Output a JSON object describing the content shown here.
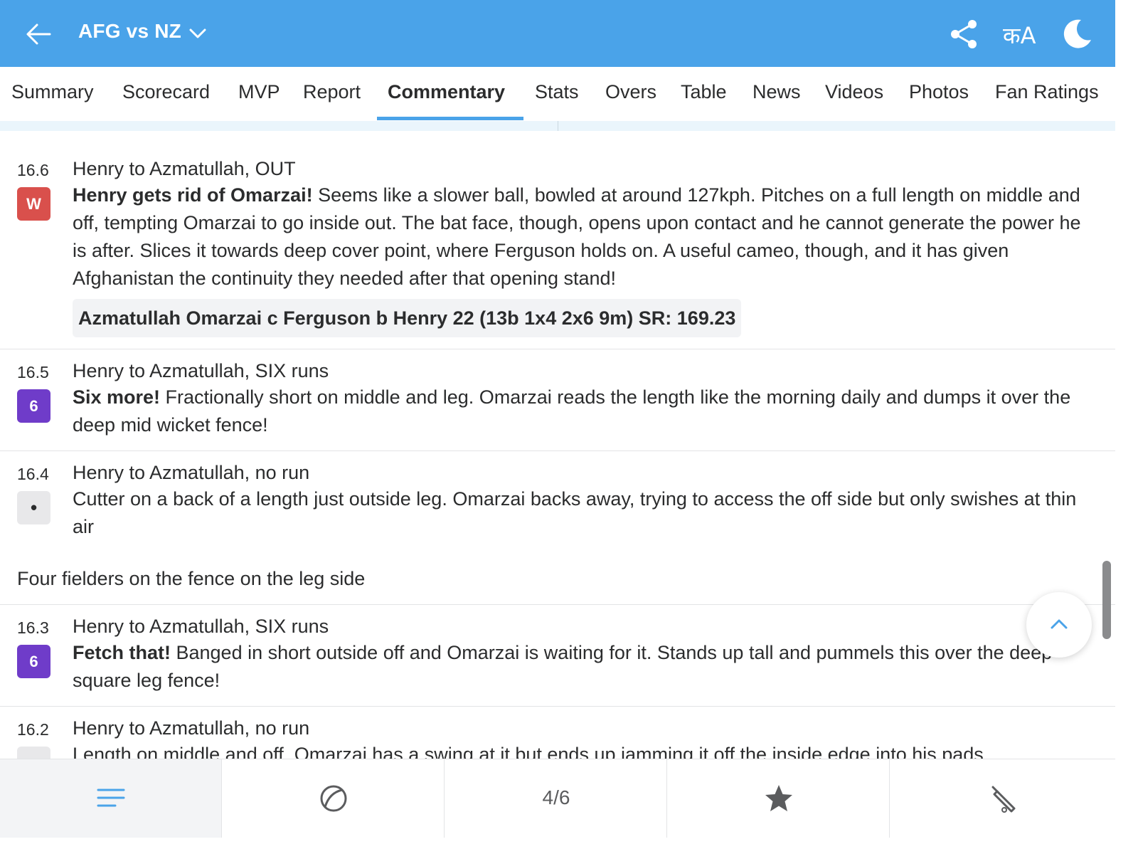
{
  "header": {
    "title": "AFG vs NZ",
    "lang_label": "कA",
    "brand_color": "#4aa3e9"
  },
  "tabs": [
    {
      "label": "Summary"
    },
    {
      "label": "Scorecard"
    },
    {
      "label": "MVP"
    },
    {
      "label": "Report"
    },
    {
      "label": "Commentary",
      "active": true
    },
    {
      "label": "Stats"
    },
    {
      "label": "Overs"
    },
    {
      "label": "Table"
    },
    {
      "label": "News"
    },
    {
      "label": "Videos"
    },
    {
      "label": "Photos"
    },
    {
      "label": "Fan Ratings"
    }
  ],
  "balls": [
    {
      "over": "16.6",
      "badge": "W",
      "badge_color": "#d9504c",
      "headline": "Henry to Azmatullah, OUT",
      "bold": "Henry gets rid of Omarzai!",
      "text": " Seems like a slower ball, bowled at around 127kph. Pitches on a full length on middle and off, tempting Omarzai to go inside out. The bat face, though, opens upon contact and he cannot generate the power he is after. Slices it towards deep cover point, where Ferguson holds on. A useful cameo, though, and it has given Afghanistan the continuity they needed after that opening stand!",
      "dismissal": "Azmatullah Omarzai c Ferguson b Henry 22 (13b 1x4 2x6 9m) SR: 169.23"
    },
    {
      "over": "16.5",
      "badge": "6",
      "badge_color": "#6f3cc9",
      "headline": "Henry to Azmatullah, SIX runs",
      "bold": "Six more!",
      "text": " Fractionally short on middle and leg. Omarzai reads the length like the morning daily and dumps it over the deep mid wicket fence!"
    },
    {
      "over": "16.4",
      "badge": "•",
      "badge_color": "#e8e8ea",
      "headline": "Henry to Azmatullah, no run",
      "bold": "",
      "text": "Cutter on a back of a length just outside leg. Omarzai backs away, trying to access the off side but only swishes at thin air",
      "note": "Four fielders on the fence on the leg side"
    },
    {
      "over": "16.3",
      "badge": "6",
      "badge_color": "#6f3cc9",
      "headline": "Henry to Azmatullah, SIX runs",
      "bold": "Fetch that!",
      "text": " Banged in short outside off and Omarzai is waiting for it. Stands up tall and pummels this over the deep square leg fence!"
    },
    {
      "over": "16.2",
      "badge": "",
      "badge_color": "#e8e8ea",
      "headline": "Henry to Azmatullah, no run",
      "bold": "",
      "text": "Length on middle and off. Omarzai has a swing at it but ends up jamming it off the inside edge into his pads."
    }
  ],
  "bottom_nav": {
    "pager": "4/6",
    "items": [
      "list-icon",
      "ball-icon",
      "pager",
      "star-icon",
      "bat-icon"
    ]
  }
}
